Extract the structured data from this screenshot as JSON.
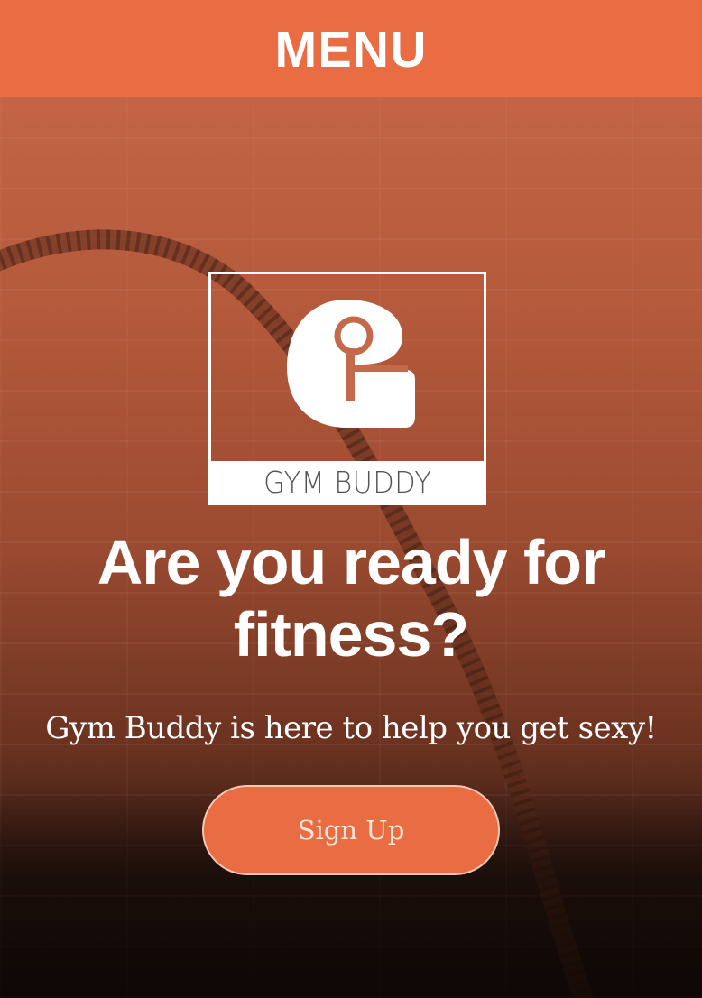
{
  "header": {
    "menu_label": "MENU"
  },
  "hero": {
    "background_image": "battle-rope-brick-wall",
    "logo": {
      "icon": "gym-buddy-g-logo-icon",
      "brand_text": "GYM BUDDY"
    },
    "headline": "Are you ready for fitness?",
    "subheadline": "Gym Buddy is here to help you get sexy!",
    "cta_label": "Sign Up"
  },
  "colors": {
    "accent": "#e96c43",
    "text": "#ffffff"
  }
}
